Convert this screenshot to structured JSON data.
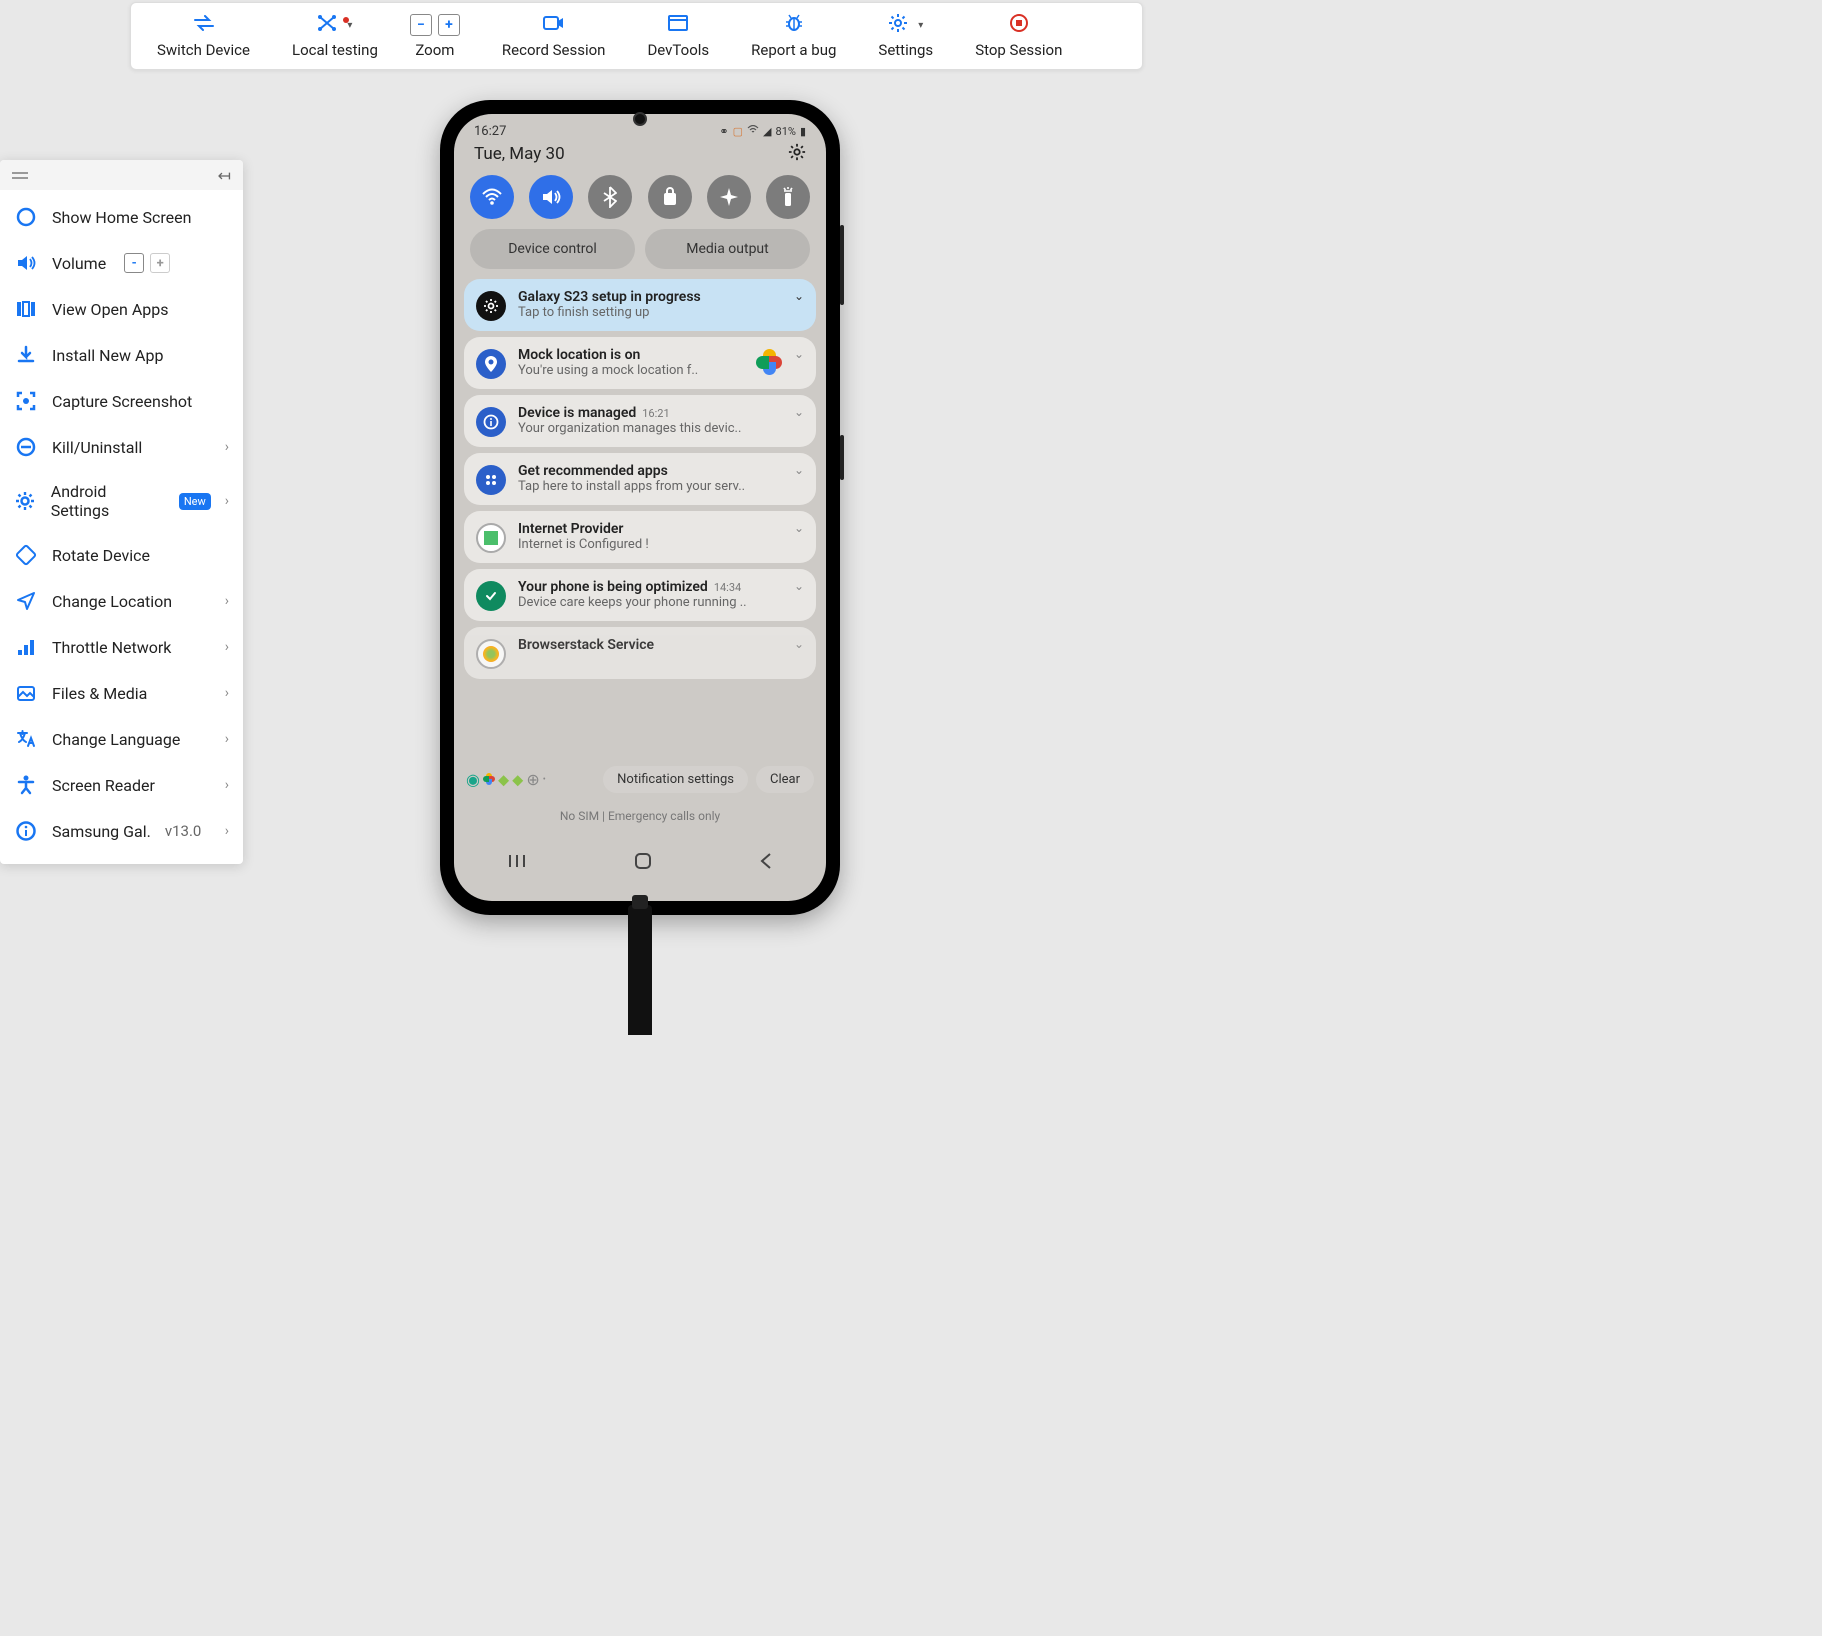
{
  "toolbar": {
    "switch_device": "Switch Device",
    "local_testing": "Local testing",
    "zoom": "Zoom",
    "record": "Record Session",
    "devtools": "DevTools",
    "bug": "Report a bug",
    "settings": "Settings",
    "stop": "Stop Session"
  },
  "sidebar": {
    "items": [
      {
        "label": "Show Home Screen"
      },
      {
        "label": "Volume"
      },
      {
        "label": "View Open Apps"
      },
      {
        "label": "Install New App"
      },
      {
        "label": "Capture Screenshot"
      },
      {
        "label": "Kill/Uninstall"
      },
      {
        "label": "Android Settings",
        "new": "New"
      },
      {
        "label": "Rotate Device"
      },
      {
        "label": "Change Location"
      },
      {
        "label": "Throttle Network"
      },
      {
        "label": "Files & Media"
      },
      {
        "label": "Change Language"
      },
      {
        "label": "Screen Reader"
      },
      {
        "label": "Samsung Gal.",
        "version": "v13.0"
      }
    ]
  },
  "phone": {
    "time": "16:27",
    "battery": "81%",
    "date": "Tue, May 30",
    "pills": {
      "device": "Device control",
      "media": "Media output"
    },
    "notifications": [
      {
        "title": "Galaxy S23 setup in progress",
        "sub": "Tap to finish setting up"
      },
      {
        "title": "Mock location is on",
        "sub": "You're using a mock location f.."
      },
      {
        "title": "Device is managed",
        "time": "16:21",
        "sub": "Your organization manages this devic.."
      },
      {
        "title": "Get recommended apps",
        "sub": "Tap here to install apps from your serv.."
      },
      {
        "title": "Internet Provider",
        "sub": "Internet is Configured !"
      },
      {
        "title": "Your phone is being optimized",
        "time": "14:34",
        "sub": "Device care keeps your phone running .."
      },
      {
        "title": "Browserstack Service",
        "sub": ""
      }
    ],
    "notif_settings": "Notification settings",
    "clear": "Clear",
    "sim": "No SIM | Emergency calls only"
  }
}
